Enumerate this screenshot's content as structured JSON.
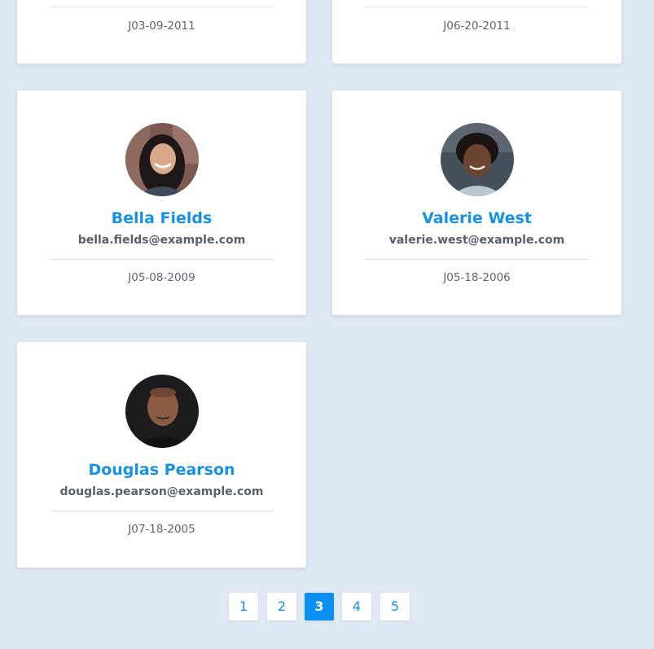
{
  "users": [
    {
      "name": "",
      "email": "",
      "date": "J03-09-2011"
    },
    {
      "name": "",
      "email": "",
      "date": "J06-20-2011"
    },
    {
      "name": "Bella Fields",
      "email": "bella.fields@example.com",
      "date": "J05-08-2009"
    },
    {
      "name": "Valerie West",
      "email": "valerie.west@example.com",
      "date": "J05-18-2006"
    },
    {
      "name": "Douglas Pearson",
      "email": "douglas.pearson@example.com",
      "date": "J07-18-2005"
    }
  ],
  "pagination": {
    "pages": [
      "1",
      "2",
      "3",
      "4",
      "5"
    ],
    "current": "3"
  },
  "colors": {
    "background": "#dfe9f4",
    "accent": "#1592e6",
    "active_page": "#0b8ff0"
  }
}
